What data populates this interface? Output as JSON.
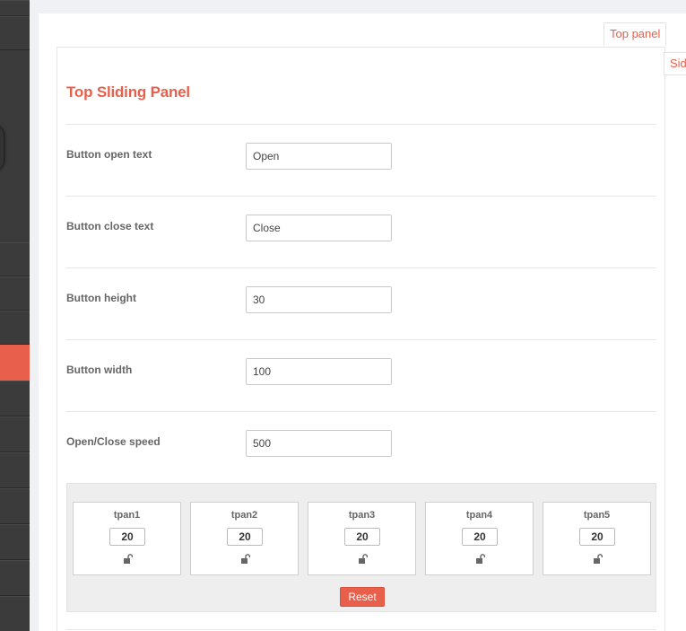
{
  "colors": {
    "accent": "#e8604c",
    "sidebar": "#3b3b3b"
  },
  "tabs": {
    "top_panel": "Top panel",
    "side_panel": "Sid"
  },
  "panel": {
    "title": "Top Sliding Panel",
    "fields": [
      {
        "label": "Button open text",
        "value": "Open"
      },
      {
        "label": "Button close text",
        "value": "Close"
      },
      {
        "label": "Button height",
        "value": "30"
      },
      {
        "label": "Button width",
        "value": "100"
      },
      {
        "label": "Open/Close speed",
        "value": "500"
      }
    ]
  },
  "columns": {
    "items": [
      {
        "name": "tpan1",
        "value": "20",
        "icon": "unlock-icon"
      },
      {
        "name": "tpan2",
        "value": "20",
        "icon": "unlock-icon"
      },
      {
        "name": "tpan3",
        "value": "20",
        "icon": "unlock-icon"
      },
      {
        "name": "tpan4",
        "value": "20",
        "icon": "unlock-icon"
      },
      {
        "name": "tpan5",
        "value": "20",
        "icon": "unlock-icon"
      }
    ],
    "reset_label": "Reset"
  }
}
